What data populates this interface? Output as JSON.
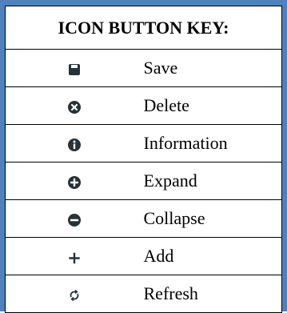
{
  "key": {
    "title": "ICON BUTTON KEY:",
    "icon_color": "#263238",
    "border_color": "#4f81bd",
    "rows": [
      {
        "icon": "save-icon",
        "label": "Save"
      },
      {
        "icon": "delete-icon",
        "label": "Delete"
      },
      {
        "icon": "information-icon",
        "label": "Information"
      },
      {
        "icon": "expand-icon",
        "label": "Expand"
      },
      {
        "icon": "collapse-icon",
        "label": "Collapse"
      },
      {
        "icon": "add-icon",
        "label": "Add"
      },
      {
        "icon": "refresh-icon",
        "label": "Refresh"
      }
    ]
  }
}
